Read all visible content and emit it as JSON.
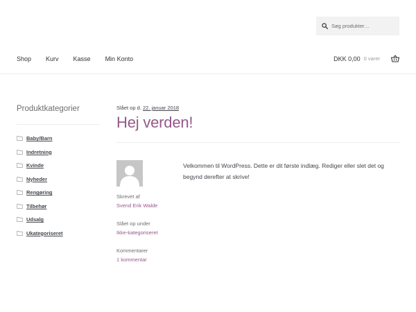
{
  "search": {
    "placeholder": "Søg produkter…"
  },
  "nav": {
    "items": [
      "Shop",
      "Kurv",
      "Kasse",
      "Min Konto"
    ]
  },
  "cart": {
    "amount": "DKK 0,00",
    "count": "0 varer"
  },
  "sidebar": {
    "title": "Produktkategorier",
    "categories": [
      "Baby/Barn",
      "Indretning",
      "Kvinde",
      "Nyheder",
      "Rengøring",
      "Tilbehør",
      "Udsalg",
      "Ukategoriseret"
    ]
  },
  "post": {
    "posted_prefix": "Slået op d.",
    "date": "22. januar 2018",
    "title": "Hej verden!",
    "author_label": "Skrevet af",
    "author": "Svend Erik Walde",
    "category_label": "Slået op under",
    "category": "Ikke-kategoriseret",
    "comments_label": "Kommentarer",
    "comments": "1 kommentar",
    "content": "Velkommen til WordPress. Dette er dit første indlæg. Rediger eller slet det og begynd derefter at skrive!"
  },
  "colors": {
    "accent": "#96588a",
    "text": "#43454b",
    "muted": "#6d6d6d",
    "search_bg": "#f2f2f2"
  }
}
